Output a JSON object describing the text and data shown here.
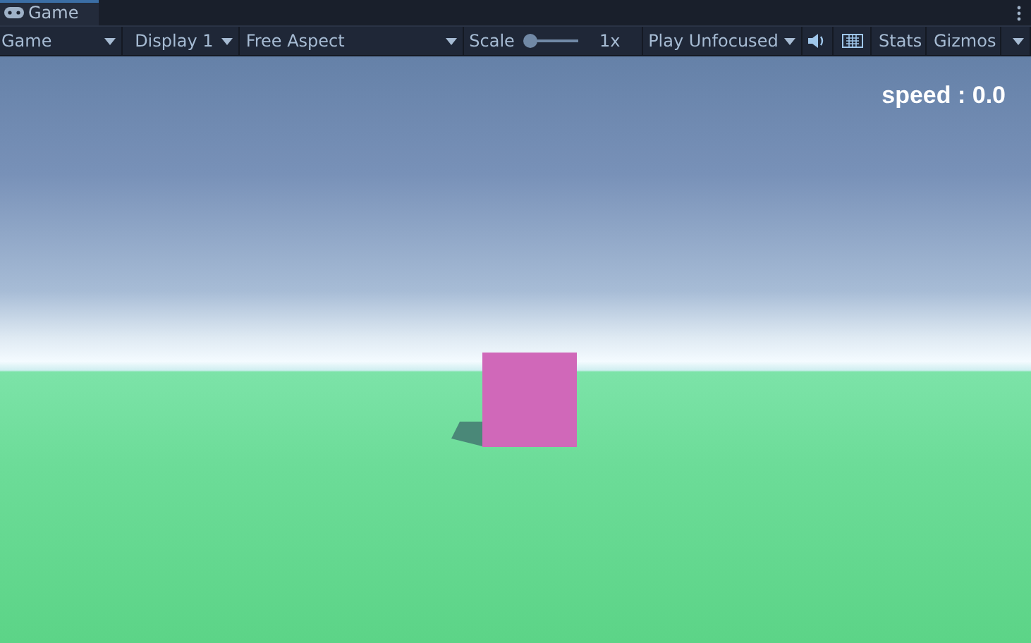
{
  "tab": {
    "label": "Game",
    "selected": true
  },
  "toolbar": {
    "view": "Game",
    "display": "Display 1",
    "aspect": "Free Aspect",
    "scale": {
      "label": "Scale",
      "level": 0.0,
      "reading": "1x"
    },
    "play_mode": "Play Unfocused",
    "audio_muted": false,
    "stats": "Stats",
    "gizmos": "Gizmos"
  },
  "hud": {
    "speed": "speed : 0.0"
  }
}
